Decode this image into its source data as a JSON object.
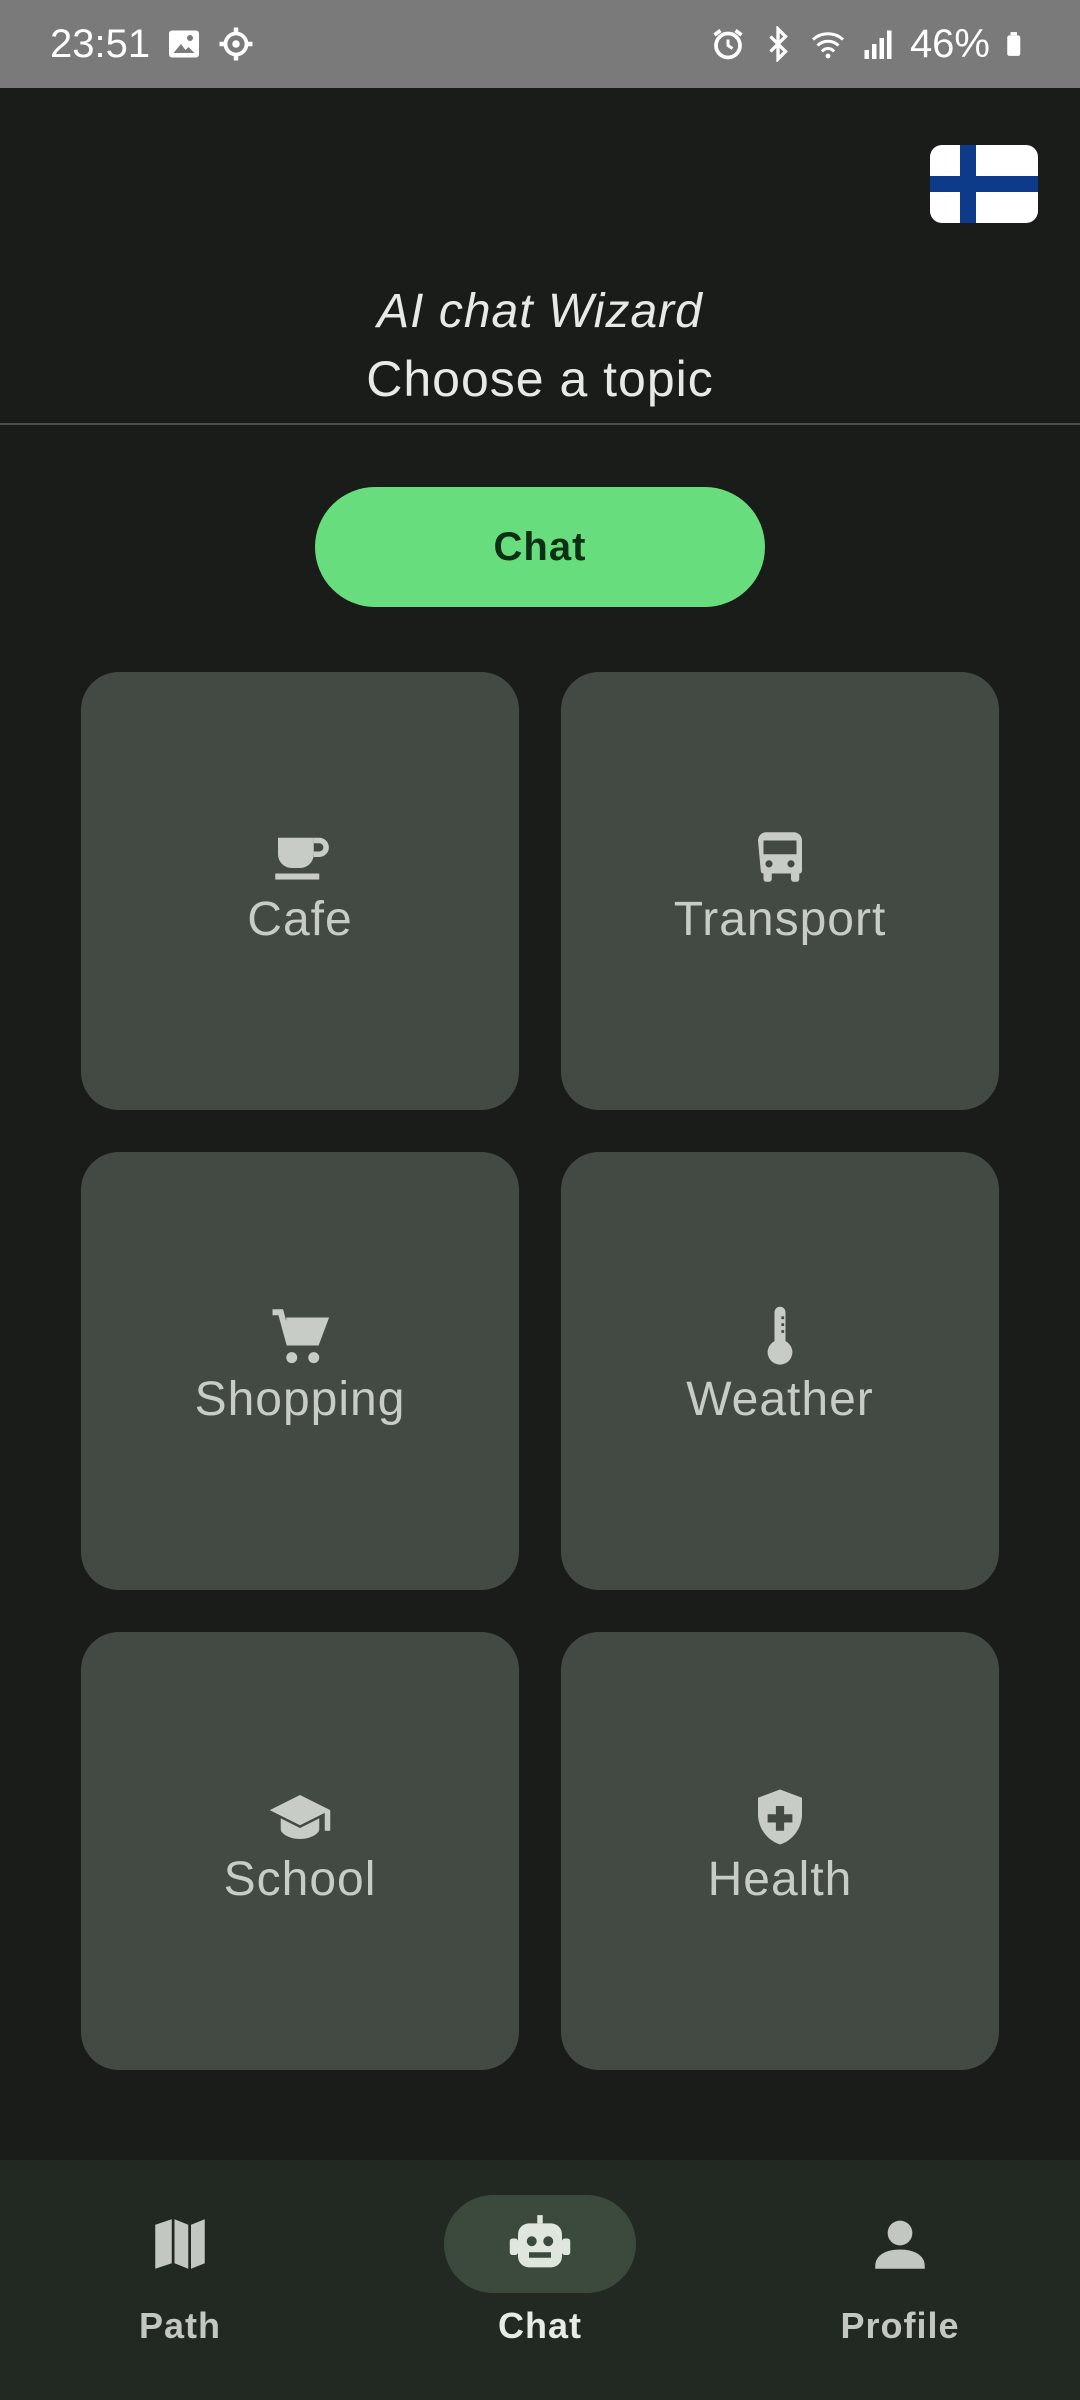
{
  "status_bar": {
    "time": "23:51",
    "battery": "46%",
    "left_icons": [
      "image-icon",
      "settings-gear-icon"
    ],
    "right_icons": [
      "alarm-icon",
      "bluetooth-icon",
      "wifi-icon",
      "signal-icon",
      "battery-icon"
    ]
  },
  "language_flag": {
    "icon": "finland-flag-icon",
    "colors": {
      "white": "#ffffff",
      "blue": "#0d3b8a"
    }
  },
  "header": {
    "app_title": "AI chat Wizard",
    "subtitle": "Choose a topic"
  },
  "chat_button": {
    "label": "Chat",
    "color": "#68dd7e"
  },
  "topics": [
    {
      "label": "Cafe",
      "icon": "coffee-cup-icon"
    },
    {
      "label": "Transport",
      "icon": "bus-icon"
    },
    {
      "label": "Shopping",
      "icon": "shopping-cart-icon"
    },
    {
      "label": "Weather",
      "icon": "thermometer-icon"
    },
    {
      "label": "School",
      "icon": "graduation-cap-icon"
    },
    {
      "label": "Health",
      "icon": "health-shield-icon"
    }
  ],
  "bottom_nav": {
    "selected": "Chat",
    "items": [
      {
        "label": "Path",
        "icon": "map-icon"
      },
      {
        "label": "Chat",
        "icon": "robot-icon"
      },
      {
        "label": "Profile",
        "icon": "person-icon"
      }
    ]
  },
  "colors": {
    "background": "#1a1c1a",
    "tile": "#434a43",
    "nav_bar": "#222822",
    "nav_active_indicator": "#3b4a3c",
    "status_bar": "#7a7a7a"
  }
}
